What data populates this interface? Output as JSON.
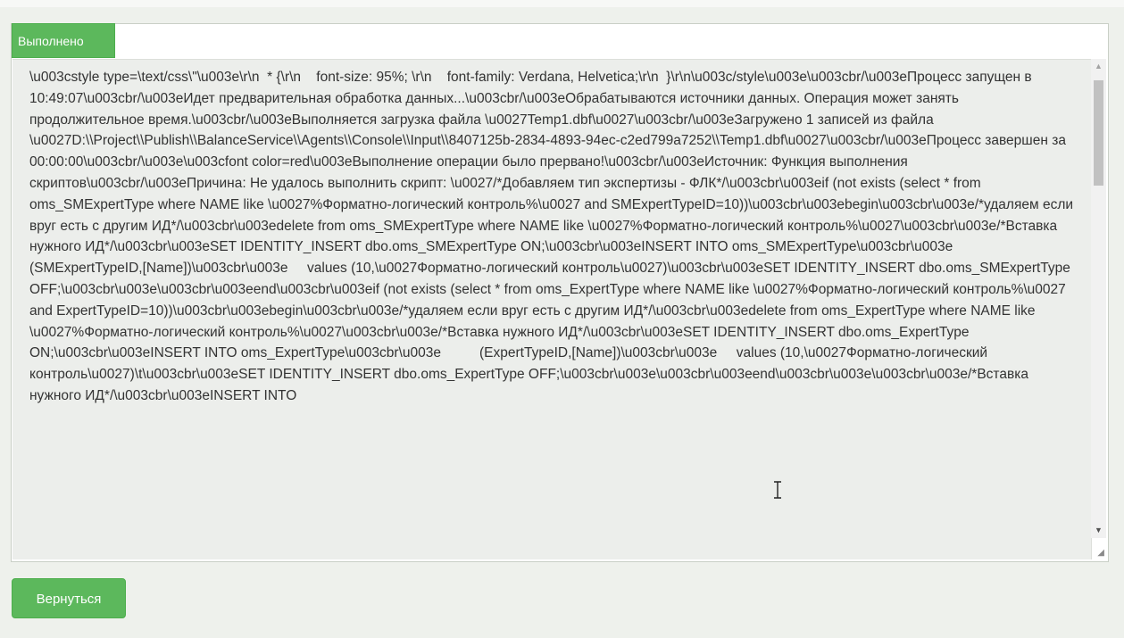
{
  "status_tab": {
    "label": "Выполнено"
  },
  "log": {
    "text": "\\u003cstyle type=\\text/css\\\"\\u003e\\r\\n  * {\\r\\n    font-size: 95%; \\r\\n    font-family: Verdana, Helvetica;\\r\\n  }\\r\\n\\u003c/style\\u003e\\u003cbr/\\u003eПроцесс запущен в 10:49:07\\u003cbr/\\u003eИдет предварительная обработка данных...\\u003cbr/\\u003eОбрабатываются источники данных. Операция может занять продолжительное время.\\u003cbr/\\u003eВыполняется загрузка файла \\u0027Temp1.dbf\\u0027\\u003cbr/\\u003eЗагружено 1 записей из файла \\u0027D:\\\\Project\\\\Publish\\\\BalanceService\\\\Agents\\\\Console\\\\Input\\\\8407125b-2834-4893-94ec-c2ed799a7252\\\\Temp1.dbf\\u0027\\u003cbr/\\u003eПроцесс завершен за 00:00:00\\u003cbr/\\u003e\\u003cfont color=red\\u003eВыполнение операции было прервано!\\u003cbr/\\u003eИсточник: Функция выполнения скриптов\\u003cbr/\\u003eПричина: Не удалось выполнить скрипт: \\u0027/*Добавляем тип экспертизы - ФЛК*/\\u003cbr\\u003eif (not exists (select * from oms_SMExpertType where NAME like \\u0027%Форматно-логический контроль%\\u0027 and SMExpertTypeID=10))\\u003cbr\\u003ebegin\\u003cbr\\u003e/*удаляем если вруг есть с другим ИД*/\\u003cbr\\u003edelete from oms_SMExpertType where NAME like \\u0027%Форматно-логический контроль%\\u0027\\u003cbr\\u003e/*Вставка нужного ИД*/\\u003cbr\\u003eSET IDENTITY_INSERT dbo.oms_SMExpertType ON;\\u003cbr\\u003eINSERT INTO oms_SMExpertType\\u003cbr\\u003e          (SMExpertTypeID,[Name])\\u003cbr\\u003e     values (10,\\u0027Форматно-логический контроль\\u0027)\\u003cbr\\u003eSET IDENTITY_INSERT dbo.oms_SMExpertType OFF;\\u003cbr\\u003e\\u003cbr\\u003eend\\u003cbr\\u003eif (not exists (select * from oms_ExpertType where NAME like \\u0027%Форматно-логический контроль%\\u0027 and ExpertTypeID=10))\\u003cbr\\u003ebegin\\u003cbr\\u003e/*удаляем если вруг есть с другим ИД*/\\u003cbr\\u003edelete from oms_ExpertType where NAME like \\u0027%Форматно-логический контроль%\\u0027\\u003cbr\\u003e/*Вставка нужного ИД*/\\u003cbr\\u003eSET IDENTITY_INSERT dbo.oms_ExpertType ON;\\u003cbr\\u003eINSERT INTO oms_ExpertType\\u003cbr\\u003e          (ExpertTypeID,[Name])\\u003cbr\\u003e     values (10,\\u0027Форматно-логический контроль\\u0027)\\t\\u003cbr\\u003eSET IDENTITY_INSERT dbo.oms_ExpertType OFF;\\u003cbr\\u003e\\u003cbr\\u003eend\\u003cbr\\u003e\\u003cbr\\u003e/*Вставка нужного ИД*/\\u003cbr\\u003eINSERT INTO"
  },
  "scrollbar": {
    "up_arrow": "▲",
    "down_arrow": "▼"
  },
  "resize_handle": {
    "glyph": "◢"
  },
  "actions": {
    "back_label": "Вернуться"
  },
  "colors": {
    "accent": "#5cb85c",
    "log_background": "#eceeeb"
  }
}
